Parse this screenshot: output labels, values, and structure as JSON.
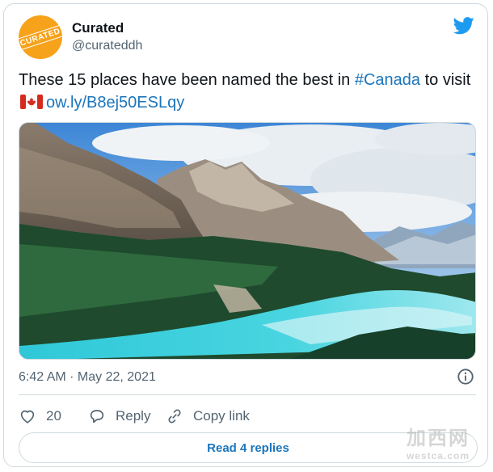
{
  "account": {
    "avatar_text": "CURATED",
    "name": "Curated",
    "handle": "@curateddh"
  },
  "tweet": {
    "text_before": "These 15 places have been named the best in ",
    "hashtag": "#Canada",
    "text_after": " to visit ",
    "flag_icon": "canada-flag-icon",
    "link": "ow.ly/B8ej50ESLqy",
    "timestamp": "6:42 AM · May 22, 2021"
  },
  "actions": {
    "like_count": "20",
    "reply_label": "Reply",
    "copy_link_label": "Copy link"
  },
  "read_replies_label": "Read 4 replies",
  "watermark": {
    "line1": "加西网",
    "line2": "westca.com"
  },
  "colors": {
    "brand": "#1d9bf0",
    "link": "#1b75bb",
    "avatar": "#f7a21b",
    "muted": "#536471"
  },
  "icons": [
    "twitter-bird-icon",
    "info-icon",
    "heart-icon",
    "reply-bubble-icon",
    "link-chain-icon"
  ]
}
